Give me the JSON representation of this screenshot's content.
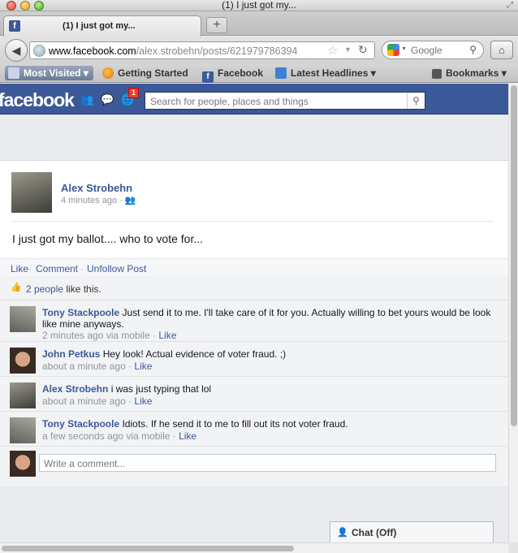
{
  "window": {
    "title": "(1) I just got my..."
  },
  "tab": {
    "label": "(1) I just got my..."
  },
  "navbar": {
    "url_domain": "www.facebook.com",
    "url_path": "/alex.strobehn/posts/621979786394",
    "search_engine": "Google"
  },
  "bookmarks": {
    "items": [
      {
        "label": "Most Visited",
        "icon": "most-visited-icon"
      },
      {
        "label": "Getting Started",
        "icon": "firefox-icon"
      },
      {
        "label": "Facebook",
        "icon": "facebook-icon"
      },
      {
        "label": "Latest Headlines",
        "icon": "rss-icon"
      },
      {
        "label": "Bookmarks",
        "icon": "bookmarks-icon"
      }
    ]
  },
  "fb": {
    "logo": "facebook",
    "notification_count": "1",
    "search_placeholder": "Search for people, places and things"
  },
  "post": {
    "author": "Alex Strobehn",
    "time": "4 minutes ago ·",
    "message": "I just got my ballot.... who to vote for...",
    "actions": {
      "like": "Like",
      "comment": "Comment",
      "unfollow": "Unfollow Post",
      "sep": "·"
    },
    "likes": {
      "count_text": "2 people",
      "suffix": " like this."
    },
    "comments": [
      {
        "author": "Tony Stackpoole",
        "text": " Just send it to me. I'll take care of it for you. Actually willing to bet yours would be look like mine anyways.",
        "meta": "2 minutes ago via mobile · ",
        "like": "Like"
      },
      {
        "author": "John Petkus",
        "text": " Hey look! Actual evidence of voter fraud. ;)",
        "meta": "about a minute ago · ",
        "like": "Like"
      },
      {
        "author": "Alex Strobehn",
        "text": " i was just typing that lol",
        "meta": "about a minute ago · ",
        "like": "Like"
      },
      {
        "author": "Tony Stackpoole",
        "text": " Idiots. If he send it to me to fill out its not voter fraud.",
        "meta": "a few seconds ago via mobile · ",
        "like": "Like"
      }
    ],
    "write_placeholder": "Write a comment..."
  },
  "chat": {
    "label": "Chat (Off)"
  }
}
